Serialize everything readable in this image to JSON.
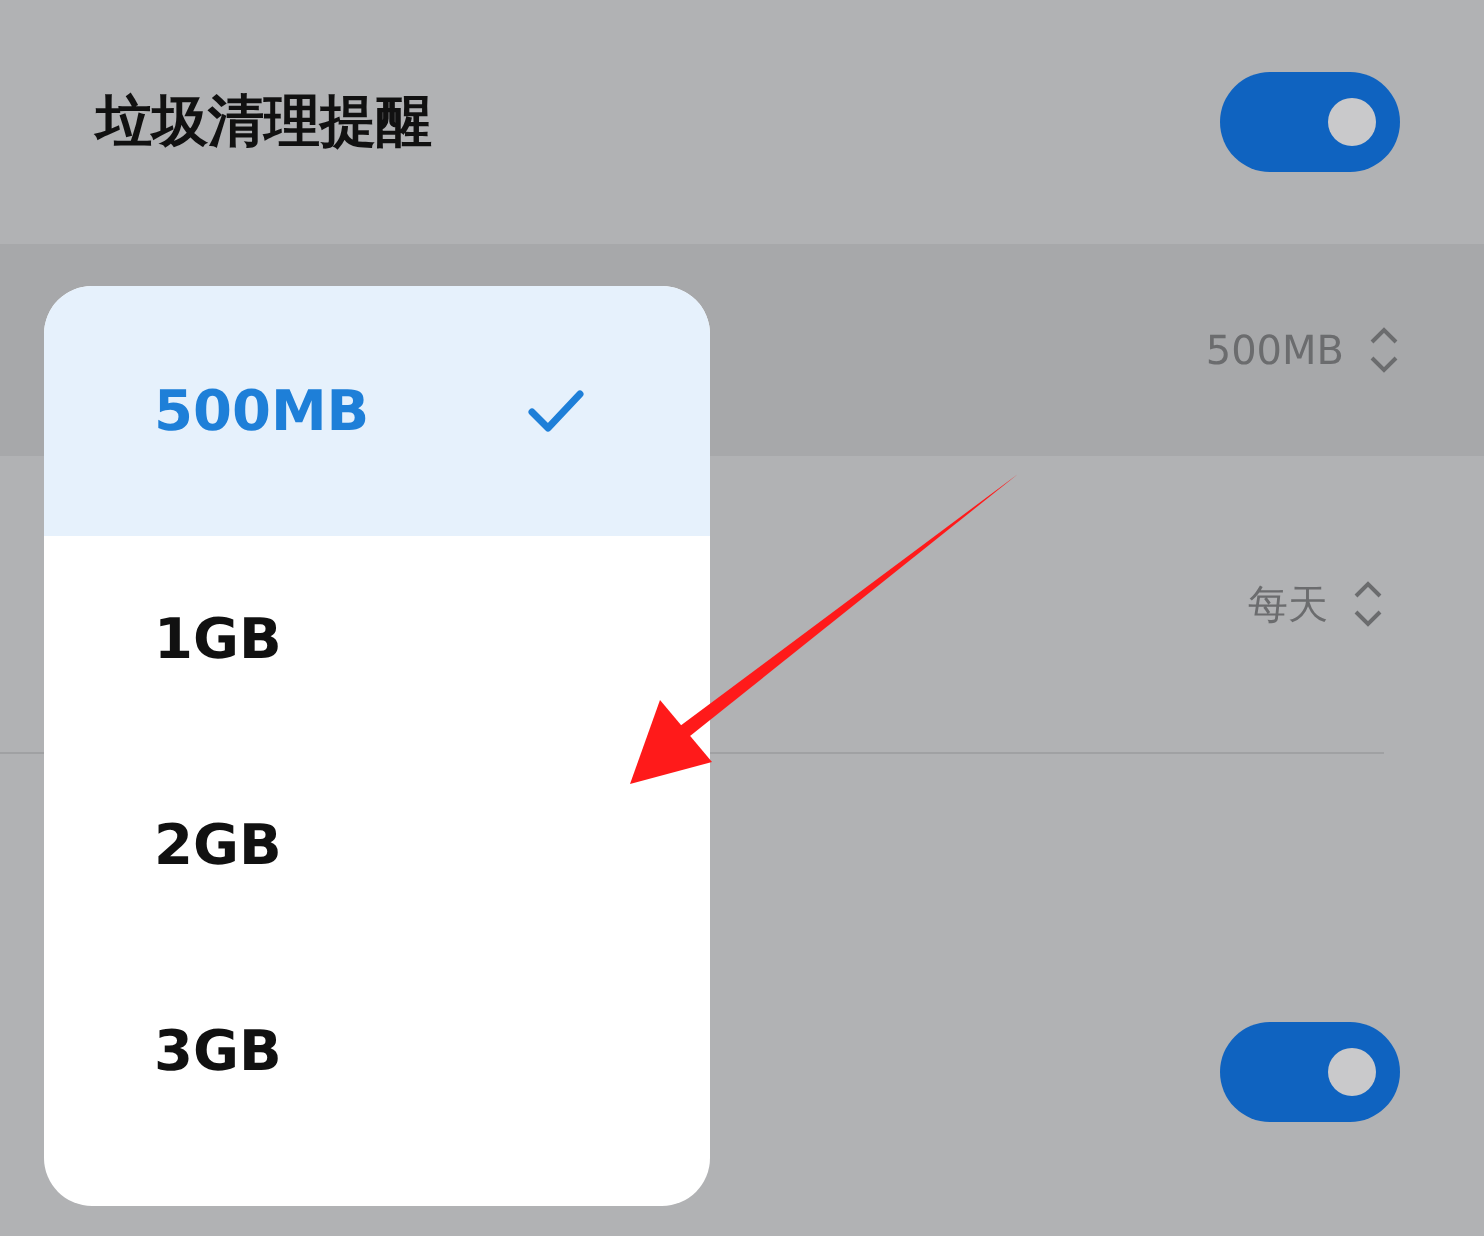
{
  "settings": [
    {
      "kind": "toggle",
      "label": "垃圾清理提醒",
      "on": true
    },
    {
      "kind": "select",
      "value": "500MB",
      "highlighted": true
    },
    {
      "kind": "select",
      "value": "每天",
      "highlighted": false
    },
    {
      "kind": "toggle",
      "on": true
    }
  ],
  "dropdown": {
    "options": [
      {
        "label": "500MB",
        "selected": true
      },
      {
        "label": "1GB",
        "selected": false
      },
      {
        "label": "2GB",
        "selected": false
      },
      {
        "label": "3GB",
        "selected": false
      }
    ]
  }
}
